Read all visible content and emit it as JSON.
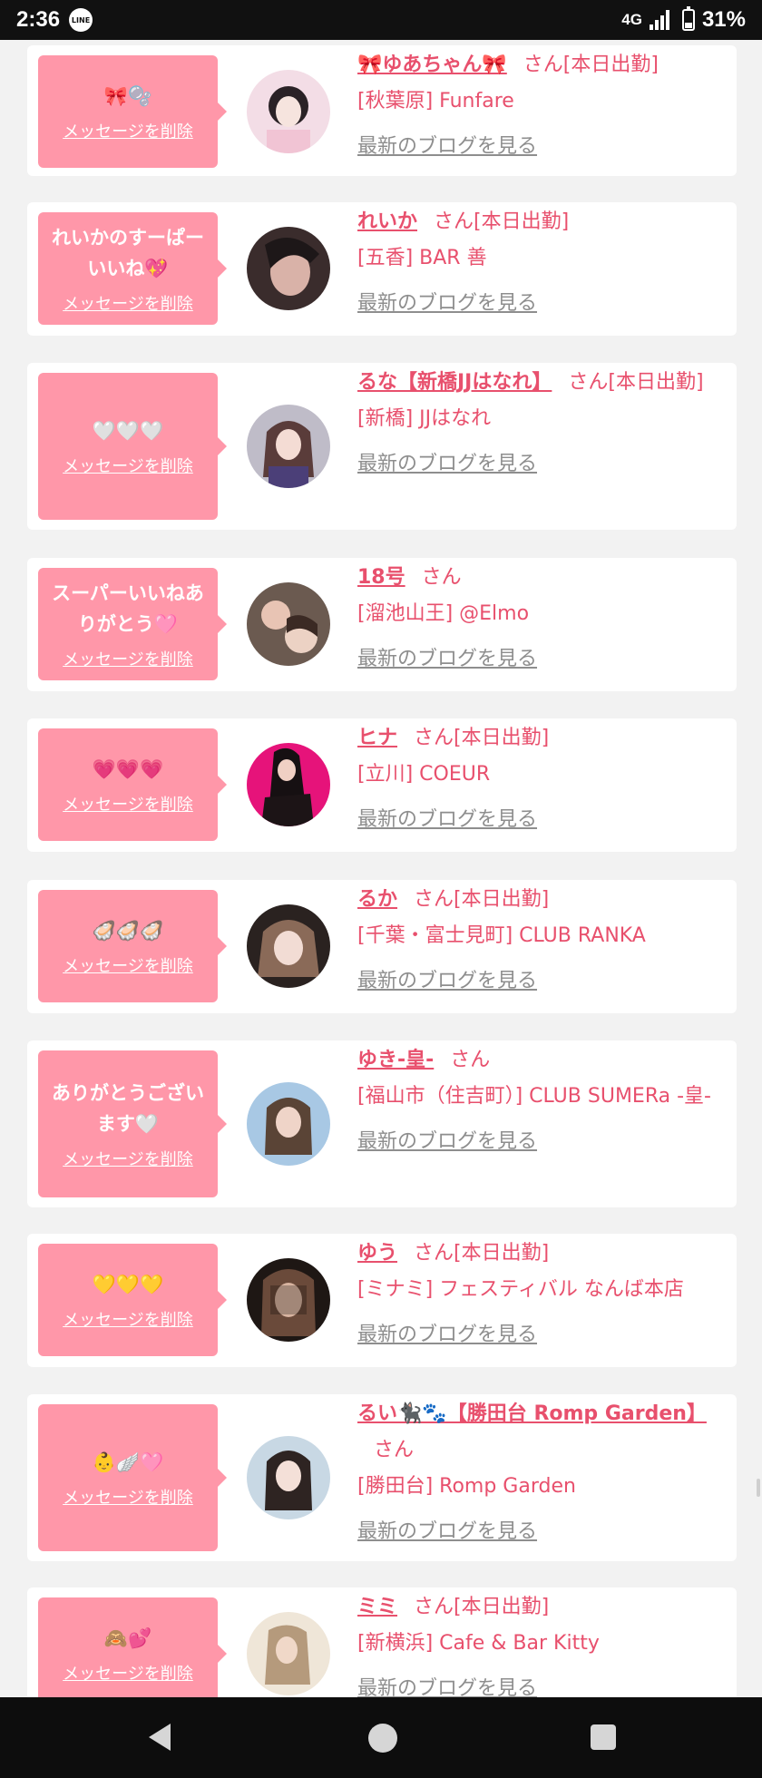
{
  "status": {
    "time": "2:36",
    "app_icon": "LINE",
    "network": "4G",
    "battery": "31%"
  },
  "colors": {
    "bubble": "#ff97a9",
    "name": "#e8506d",
    "blog": "#8e8e8e"
  },
  "delete_label": "メッセージを削除",
  "blog_label": "最新のブログを見る",
  "cards": [
    {
      "message": "🎀🫧",
      "name": "🎀ゆあちゃん🎀",
      "suffix": "さん[本日出勤]",
      "shop": "[秋葉原] Funfare"
    },
    {
      "message": "れいかのすーぱーいいね💖",
      "name": "れいか",
      "suffix": "さん[本日出勤]",
      "shop": "[五香] BAR 善"
    },
    {
      "message": "🤍🤍🤍",
      "name": "るな【新橋JJはなれ】",
      "suffix": "さん[本日出勤]",
      "shop": "[新橋] JJはなれ"
    },
    {
      "message": "スーパーいいねありがとう🩷",
      "name": "18号",
      "suffix": "さん",
      "shop": "[溜池山王] @Elmo"
    },
    {
      "message": "💗💗💗",
      "name": "ヒナ",
      "suffix": "さん[本日出勤]",
      "shop": "[立川] COEUR"
    },
    {
      "message": "🦪🦪🦪",
      "name": "るか",
      "suffix": "さん[本日出勤]",
      "shop": "[千葉・富士見町] CLUB RANKA"
    },
    {
      "message": "ありがとうございます🤍",
      "name": "ゆき-皇-",
      "suffix": "さん",
      "shop": "[福山市（住吉町）] CLUB SUMERa -皇-"
    },
    {
      "message": "💛💛💛",
      "name": "ゆう",
      "suffix": "さん[本日出勤]",
      "shop": "[ミナミ] フェスティバル なんば本店"
    },
    {
      "message": "👶🪽🩷",
      "name": "るい🐈‍⬛🐾【勝田台 Romp Garden】",
      "suffix": "さん",
      "shop": "[勝田台] Romp Garden"
    },
    {
      "message": "🙈💕",
      "name": "ミミ",
      "suffix": "さん[本日出勤]",
      "shop": "[新横浜] Cafe & Bar Kitty"
    }
  ]
}
